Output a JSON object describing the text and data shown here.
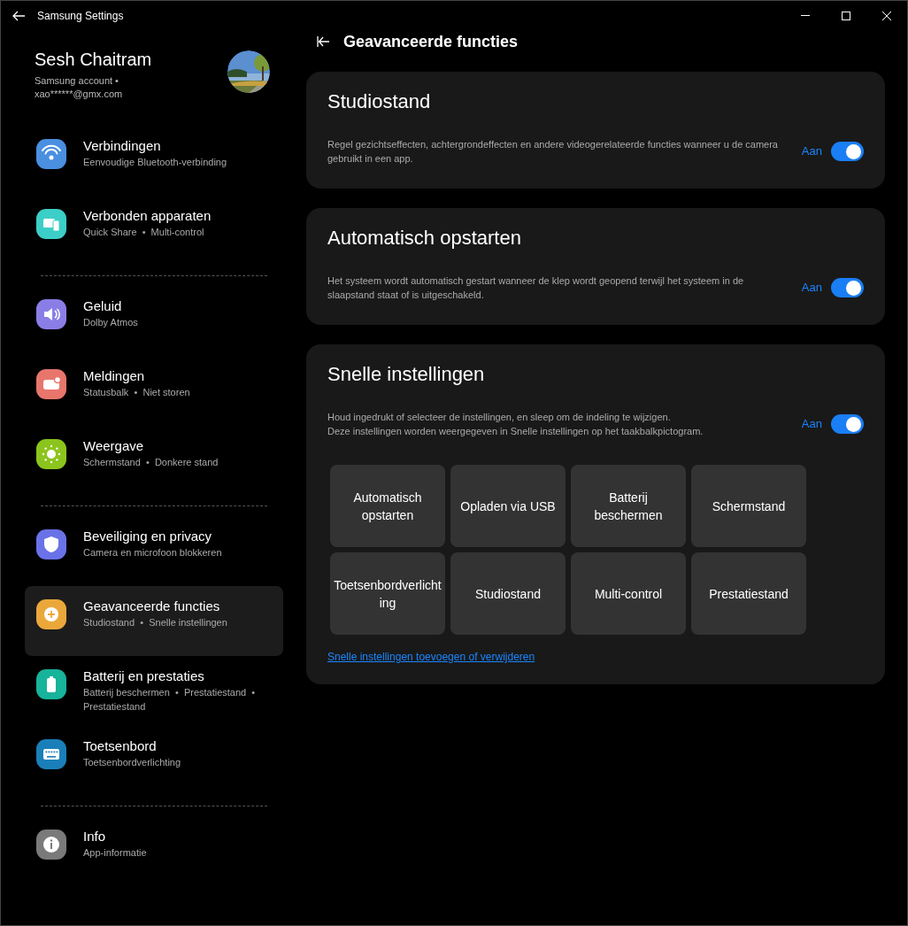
{
  "window": {
    "title": "Samsung Settings"
  },
  "account": {
    "name": "Sesh Chaitram",
    "line": "Samsung account •",
    "email": "xao******@gmx.com"
  },
  "sidebar": {
    "groups": [
      {
        "items": [
          {
            "kind": "wifi",
            "color": "#4a8fe0",
            "title": "Verbindingen",
            "subtitle": "Eenvoudige Bluetooth-verbinding",
            "selected": false
          },
          {
            "kind": "devices",
            "color": "#3ccfc7",
            "title": "Verbonden apparaten",
            "subtitle": "Quick Share  •  Multi-control",
            "selected": false
          }
        ]
      },
      {
        "items": [
          {
            "kind": "sound",
            "color": "#8a7ee6",
            "title": "Geluid",
            "subtitle": "Dolby Atmos",
            "selected": false
          },
          {
            "kind": "notify",
            "color": "#e8766c",
            "title": "Meldingen",
            "subtitle": "Statusbalk  •  Niet storen",
            "selected": false
          },
          {
            "kind": "sun",
            "color": "#8cc41e",
            "title": "Weergave",
            "subtitle": "Schermstand  •  Donkere stand",
            "selected": false
          }
        ]
      },
      {
        "items": [
          {
            "kind": "shield",
            "color": "#6a72e8",
            "title": "Beveiliging en privacy",
            "subtitle": "Camera en microfoon blokkeren",
            "selected": false
          },
          {
            "kind": "gear",
            "color": "#eaa83a",
            "title": "Geavanceerde functies",
            "subtitle": "Studiostand  •  Snelle instellingen",
            "selected": true
          },
          {
            "kind": "battery",
            "color": "#17b39a",
            "title": "Batterij en prestaties",
            "subtitle": "Batterij beschermen  •  Prestatiestand  •  Prestatiestand",
            "selected": false
          },
          {
            "kind": "keyboard",
            "color": "#1a7fb8",
            "title": "Toetsenbord",
            "subtitle": "Toetsenbordverlichting",
            "selected": false
          }
        ]
      },
      {
        "items": [
          {
            "kind": "info",
            "color": "#7a7a7a",
            "title": "Info",
            "subtitle": "App-informatie",
            "selected": false
          }
        ]
      }
    ]
  },
  "page": {
    "title": "Geavanceerde functies"
  },
  "cards": [
    {
      "title": "Studiostand",
      "description": [
        "Regel gezichtseffecten, achtergrondeffecten en andere videogerelateerde functies wanneer u de camera gebruikt in een app."
      ],
      "toggle_label": "Aan",
      "on": true
    },
    {
      "title": "Automatisch opstarten",
      "description": [
        "Het systeem wordt automatisch gestart wanneer de klep wordt geopend terwijl het systeem in de slaapstand staat of is uitgeschakeld."
      ],
      "toggle_label": "Aan",
      "on": true
    },
    {
      "title": "Snelle instellingen",
      "description": [
        "Houd ingedrukt of selecteer de instellingen, en sleep om de indeling te wijzigen.",
        "Deze instellingen worden weergegeven in Snelle instellingen op het taakbalkpictogram."
      ],
      "toggle_label": "Aan",
      "on": true,
      "tiles": [
        "Automatisch opstarten",
        "Opladen via USB",
        "Batterij beschermen",
        "Schermstand",
        "Toetsenbordverlichting",
        "Studiostand",
        "Multi-control",
        "Prestatiestand"
      ],
      "link": "Snelle instellingen toevoegen of verwijderen"
    }
  ]
}
